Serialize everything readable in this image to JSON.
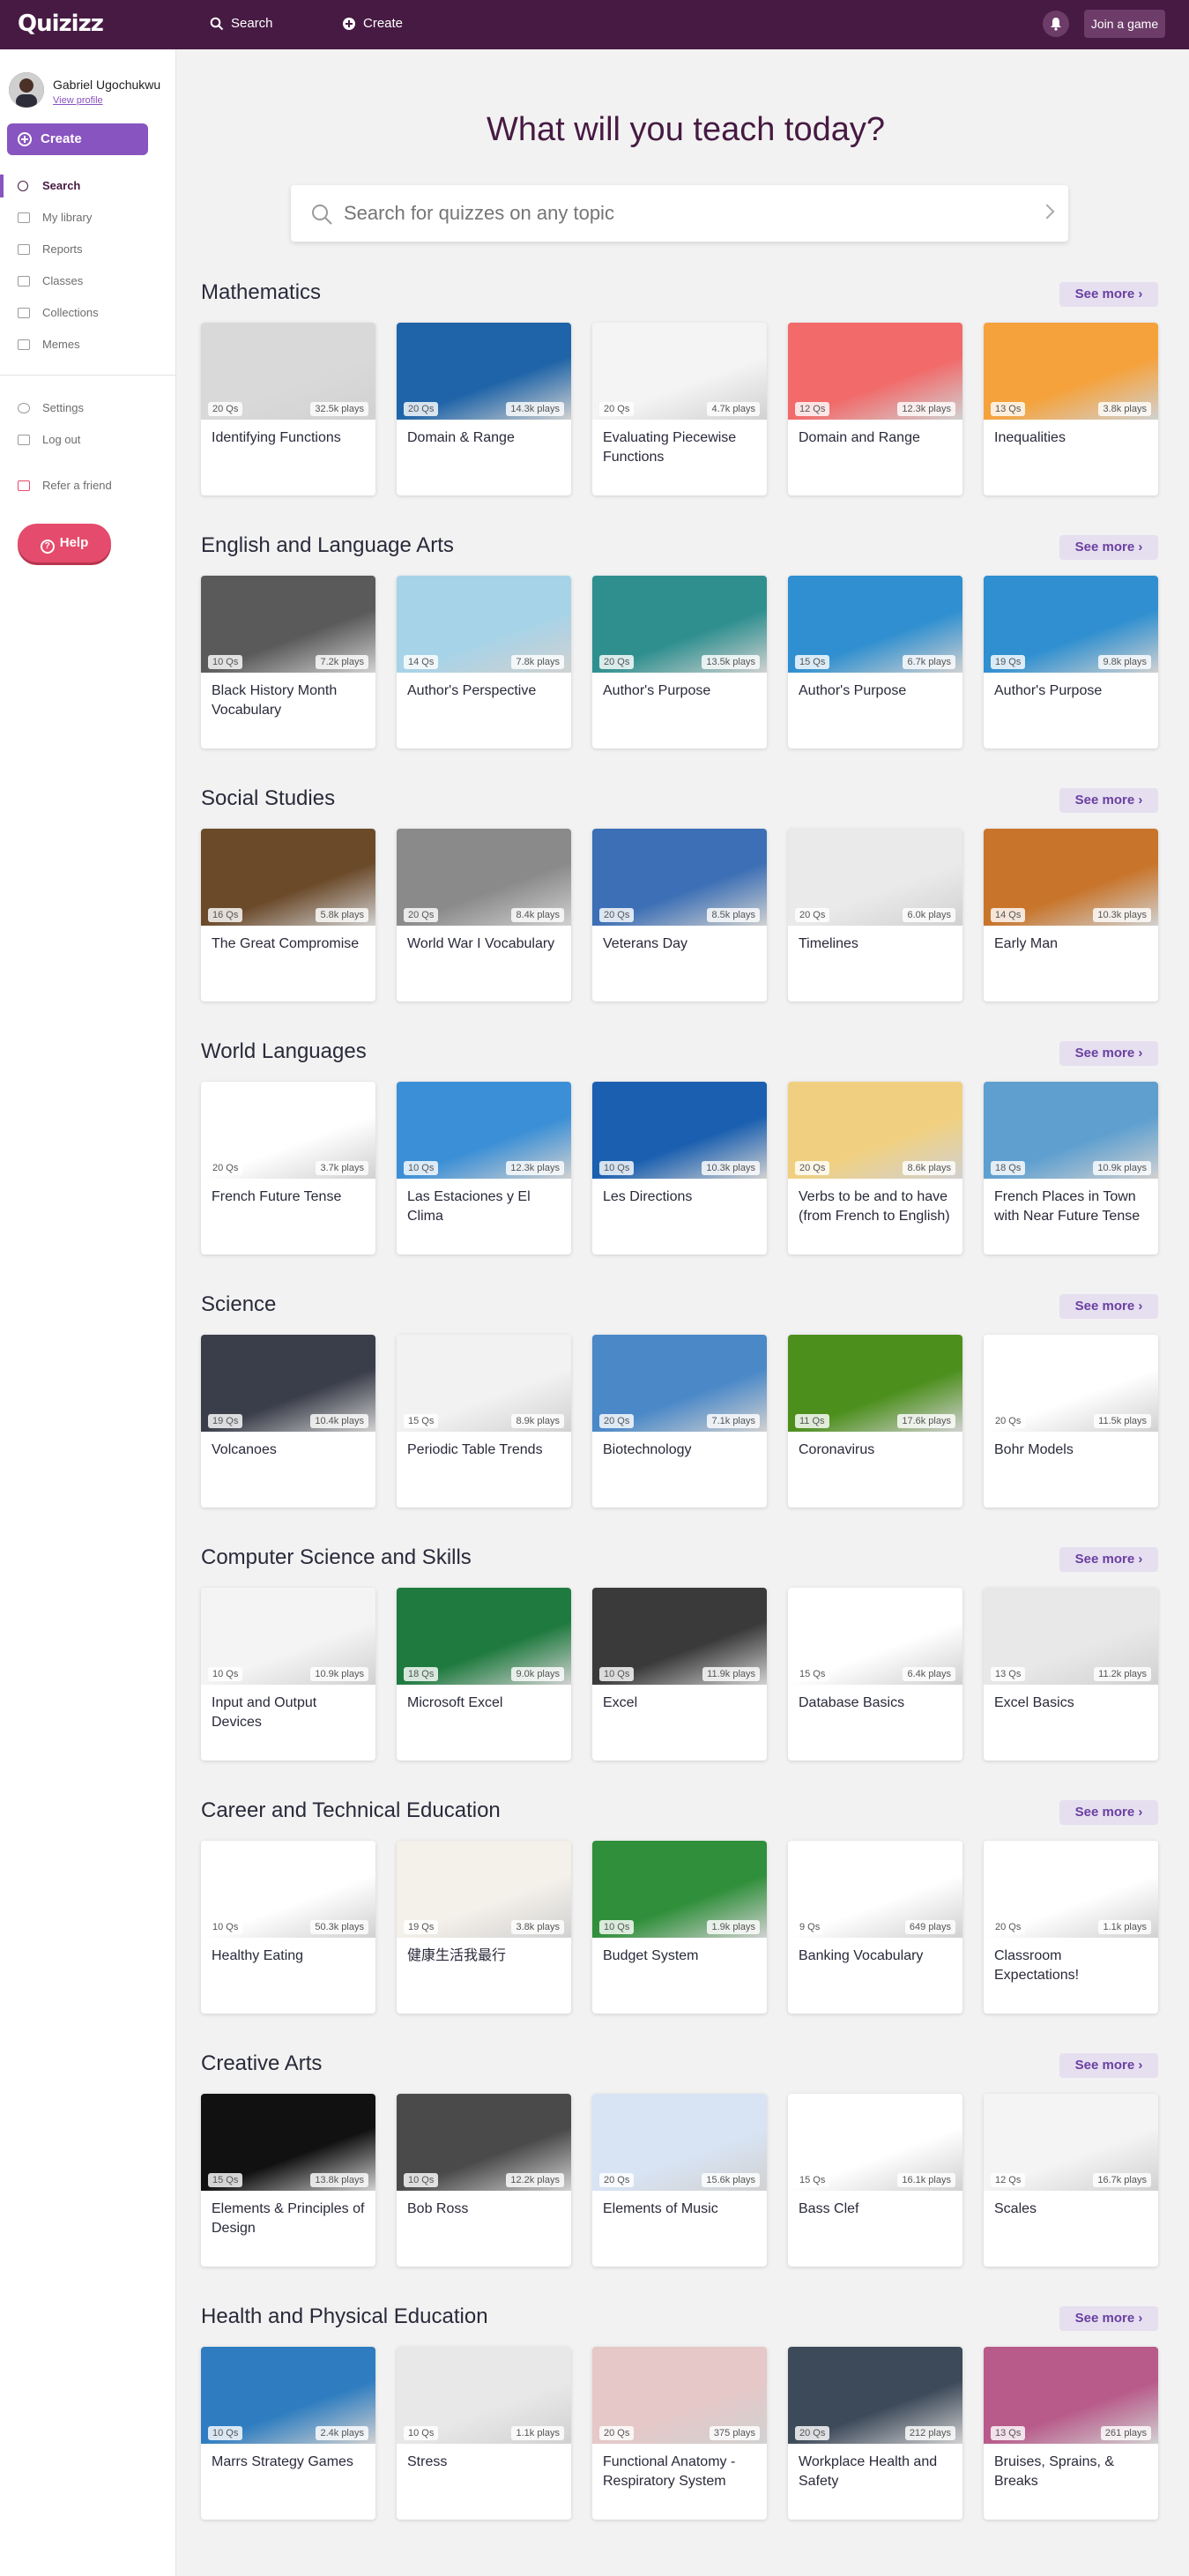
{
  "topbar": {
    "logo": "Quizizz",
    "search": "Search",
    "create": "Create",
    "join": "Join a game"
  },
  "user": {
    "name": "Gabriel Ugochukwu",
    "view_profile": "View profile"
  },
  "sidebar": {
    "create": "Create",
    "items": [
      "Search",
      "My library",
      "Reports",
      "Classes",
      "Collections",
      "Memes"
    ],
    "items2": [
      "Settings",
      "Log out"
    ],
    "refer": "Refer a friend",
    "help": "Help"
  },
  "main": {
    "heading": "What will you teach today?",
    "search_placeholder": "Search for quizzes on any topic",
    "see_more": "See more"
  },
  "sections": [
    {
      "title": "Mathematics",
      "cards": [
        {
          "title": "Identifying Functions",
          "qs": "20 Qs",
          "plays": "32.5k plays"
        },
        {
          "title": "Domain & Range",
          "qs": "20 Qs",
          "plays": "14.3k plays"
        },
        {
          "title": "Evaluating Piecewise Functions",
          "qs": "20 Qs",
          "plays": "4.7k plays"
        },
        {
          "title": "Domain and Range",
          "qs": "12 Qs",
          "plays": "12.3k plays"
        },
        {
          "title": "Inequalities",
          "qs": "13 Qs",
          "plays": "3.8k plays"
        }
      ]
    },
    {
      "title": "English and Language Arts",
      "cards": [
        {
          "title": "Black History Month Vocabulary",
          "qs": "10 Qs",
          "plays": "7.2k plays"
        },
        {
          "title": "Author's Perspective",
          "qs": "14 Qs",
          "plays": "7.8k plays"
        },
        {
          "title": "Author's Purpose",
          "qs": "20 Qs",
          "plays": "13.5k plays"
        },
        {
          "title": "Author's Purpose",
          "qs": "15 Qs",
          "plays": "6.7k plays"
        },
        {
          "title": "Author's Purpose",
          "qs": "19 Qs",
          "plays": "9.8k plays"
        }
      ]
    },
    {
      "title": "Social Studies",
      "cards": [
        {
          "title": "The Great Compromise",
          "qs": "16 Qs",
          "plays": "5.8k plays"
        },
        {
          "title": "World War I Vocabulary",
          "qs": "20 Qs",
          "plays": "8.4k plays"
        },
        {
          "title": "Veterans Day",
          "qs": "20 Qs",
          "plays": "8.5k plays"
        },
        {
          "title": "Timelines",
          "qs": "20 Qs",
          "plays": "6.0k plays"
        },
        {
          "title": "Early Man",
          "qs": "14 Qs",
          "plays": "10.3k plays"
        }
      ]
    },
    {
      "title": "World Languages",
      "cards": [
        {
          "title": "French Future Tense",
          "qs": "20 Qs",
          "plays": "3.7k plays"
        },
        {
          "title": "Las Estaciones y El Clima",
          "qs": "10 Qs",
          "plays": "12.3k plays"
        },
        {
          "title": "Les Directions",
          "qs": "10 Qs",
          "plays": "10.3k plays"
        },
        {
          "title": "Verbs to be and to have (from French to English)",
          "qs": "20 Qs",
          "plays": "8.6k plays"
        },
        {
          "title": "French Places in Town with Near Future Tense",
          "qs": "18 Qs",
          "plays": "10.9k plays"
        }
      ]
    },
    {
      "title": "Science",
      "cards": [
        {
          "title": "Volcanoes",
          "qs": "19 Qs",
          "plays": "10.4k plays"
        },
        {
          "title": "Periodic Table Trends",
          "qs": "15 Qs",
          "plays": "8.9k plays"
        },
        {
          "title": "Biotechnology",
          "qs": "20 Qs",
          "plays": "7.1k plays"
        },
        {
          "title": "Coronavirus",
          "qs": "11 Qs",
          "plays": "17.6k plays"
        },
        {
          "title": "Bohr Models",
          "qs": "20 Qs",
          "plays": "11.5k plays"
        }
      ]
    },
    {
      "title": "Computer Science and Skills",
      "cards": [
        {
          "title": "Input and Output Devices",
          "qs": "10 Qs",
          "plays": "10.9k plays"
        },
        {
          "title": "Microsoft Excel",
          "qs": "18 Qs",
          "plays": "9.0k plays"
        },
        {
          "title": "Excel",
          "qs": "10 Qs",
          "plays": "11.9k plays"
        },
        {
          "title": "Database Basics",
          "qs": "15 Qs",
          "plays": "6.4k plays"
        },
        {
          "title": "Excel Basics",
          "qs": "13 Qs",
          "plays": "11.2k plays"
        }
      ]
    },
    {
      "title": "Career and Technical Education",
      "cards": [
        {
          "title": "Healthy Eating",
          "qs": "10 Qs",
          "plays": "50.3k plays"
        },
        {
          "title": "健康生活我最行",
          "qs": "19 Qs",
          "plays": "3.8k plays"
        },
        {
          "title": "Budget System",
          "qs": "10 Qs",
          "plays": "1.9k plays"
        },
        {
          "title": "Banking Vocabulary",
          "qs": "9 Qs",
          "plays": "649 plays"
        },
        {
          "title": "Classroom Expectations!",
          "qs": "20 Qs",
          "plays": "1.1k plays"
        }
      ]
    },
    {
      "title": "Creative Arts",
      "cards": [
        {
          "title": "Elements & Principles of Design",
          "qs": "15 Qs",
          "plays": "13.8k plays"
        },
        {
          "title": "Bob Ross",
          "qs": "10 Qs",
          "plays": "12.2k plays"
        },
        {
          "title": "Elements of Music",
          "qs": "20 Qs",
          "plays": "15.6k plays"
        },
        {
          "title": "Bass Clef",
          "qs": "15 Qs",
          "plays": "16.1k plays"
        },
        {
          "title": "Scales",
          "qs": "12 Qs",
          "plays": "16.7k plays"
        }
      ]
    },
    {
      "title": "Health and Physical Education",
      "cards": [
        {
          "title": "Marrs Strategy Games",
          "qs": "10 Qs",
          "plays": "2.4k plays"
        },
        {
          "title": "Stress",
          "qs": "10 Qs",
          "plays": "1.1k plays"
        },
        {
          "title": "Functional Anatomy - Respiratory System",
          "qs": "20 Qs",
          "plays": "375 plays"
        },
        {
          "title": "Workplace Health and Safety",
          "qs": "20 Qs",
          "plays": "212 plays"
        },
        {
          "title": "Bruises, Sprains, & Breaks",
          "qs": "13 Qs",
          "plays": "261 plays"
        }
      ]
    }
  ],
  "thumb_colors": [
    [
      "#d9d9d9",
      "#1f64a8",
      "#f4f4f4",
      "#f26a6a",
      "#f5a23c"
    ],
    [
      "#5a5a5a",
      "#a6d3e8",
      "#2f8f8f",
      "#2f8fd0",
      "#2f8fd0"
    ],
    [
      "#6b4a2a",
      "#8a8a8a",
      "#3c6fb5",
      "#eaeaea",
      "#c8742a"
    ],
    [
      "#ffffff",
      "#3b8fd6",
      "#1a5fb0",
      "#f0d080",
      "#5e9fd0"
    ],
    [
      "#3a3d4a",
      "#f2f2f2",
      "#4a88c8",
      "#4c8f1c",
      "#ffffff"
    ],
    [
      "#f4f4f4",
      "#1e7a3e",
      "#3a3a3a",
      "#ffffff",
      "#e8e8e8"
    ],
    [
      "#ffffff",
      "#f4f0ea",
      "#2f8f3a",
      "#ffffff",
      "#ffffff"
    ],
    [
      "#111111",
      "#4a4a4a",
      "#d8e4f4",
      "#ffffff",
      "#f4f4f4"
    ],
    [
      "#2f7dc0",
      "#e8e8e8",
      "#e6c8c8",
      "#3d4a5a",
      "#b85a8a"
    ]
  ]
}
